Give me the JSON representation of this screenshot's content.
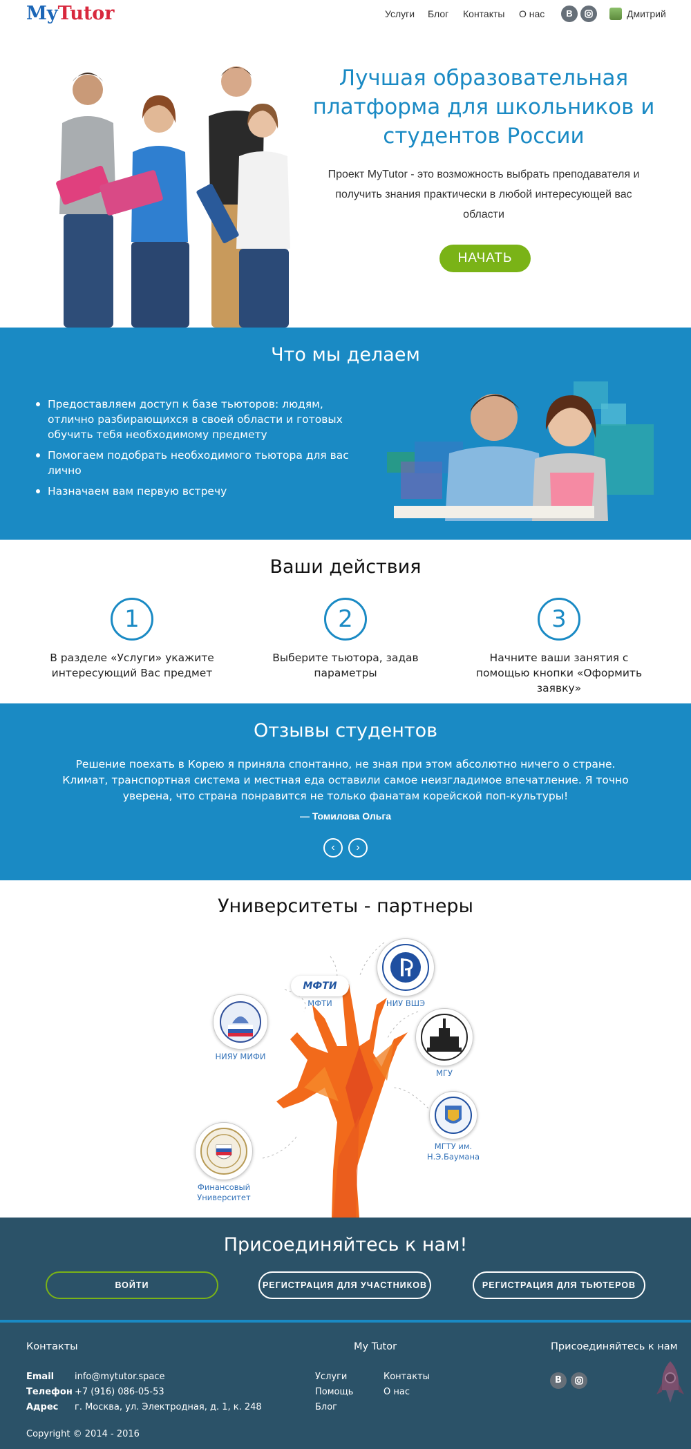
{
  "header": {
    "logo_my": "My",
    "logo_tutor": "Tutor",
    "nav": [
      "Услуги",
      "Блог",
      "Контакты",
      "О нас"
    ],
    "social_vk": "В",
    "user_name": "Дмитрий"
  },
  "hero": {
    "title": "Лучшая образовательная платформа для школьников и студентов России",
    "text": "Проект MyTutor - это возможность выбрать преподавателя и получить знания практически в любой интересующей вас области",
    "button": "НАЧАТЬ"
  },
  "what": {
    "title": "Что мы делаем",
    "items": [
      "Предоставляем доступ к базе тьюторов: людям, отлично разбирающихся в своей области и готовых обучить тебя необходимому предмету",
      "Помогаем подобрать необходимого тьютора для вас лично",
      "Назначаем вам первую встречу"
    ]
  },
  "steps": {
    "title": "Ваши действия",
    "items": [
      {
        "num": "1",
        "text": "В разделе «Услуги» укажите интересующий Вас предмет"
      },
      {
        "num": "2",
        "text": "Выберите тьютора, задав параметры"
      },
      {
        "num": "3",
        "text": "Начните ваши занятия с помощью кнопки «Оформить заявку»"
      }
    ]
  },
  "reviews": {
    "title": "Отзывы студентов",
    "text": "Решение поехать в Корею я приняла спонтанно, не зная при этом абсолютно ничего о стране. Климат, транспортная система и местная еда оставили самое неизгладимое впечатление. Я точно уверена, что страна понравится не только фанатам корейской поп-культуры!",
    "author": "—   Томилова Ольга"
  },
  "partners": {
    "title": "Университеты - партнеры",
    "unis": {
      "mifi": "НИЯУ МИФИ",
      "mfti": "МФТИ",
      "mfti_logo": "МФТИ",
      "hse": "НИУ ВШЭ",
      "mgu": "МГУ",
      "bauman": "МГТУ им. Н.Э.Баумана",
      "finance": "Финансовый Университет"
    }
  },
  "join": {
    "title": "Присоединяйтесь к нам!",
    "login": "ВОЙТИ",
    "reg_members": "РЕГИСТРАЦИЯ ДЛЯ УЧАСТНИКОВ",
    "reg_tutors": "РЕГИСТРАЦИЯ ДЛЯ ТЬЮТЕРОВ"
  },
  "footer": {
    "contacts_title": "Контакты",
    "brand_title": "My Tutor",
    "join_title": "Присоединяйтесь к нам",
    "email_label": "Email",
    "email": "info@mytutor.space",
    "phone_label": "Телефон",
    "phone": "+7 (916) 086-05-53",
    "address_label": "Адрес",
    "address": "г. Москва, ул. Электродная, д. 1, к. 248",
    "links": [
      "Услуги",
      "Контакты",
      "Помощь",
      "О нас",
      "Блог"
    ],
    "copyright": "Copyright © 2014 - 2016"
  }
}
